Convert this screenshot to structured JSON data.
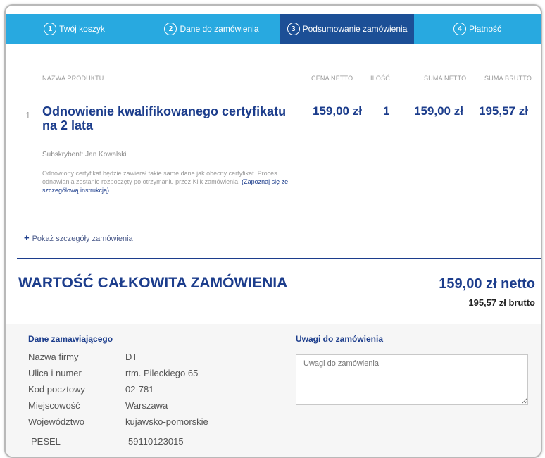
{
  "steps": [
    {
      "num": "1",
      "label": "Twój koszyk"
    },
    {
      "num": "2",
      "label": "Dane do zamówienia"
    },
    {
      "num": "3",
      "label": "Podsumowanie zamówienia"
    },
    {
      "num": "4",
      "label": "Płatność"
    }
  ],
  "active_step": 3,
  "table": {
    "headers": [
      "NAZWA PRODUKTU",
      "CENA NETTO",
      "ILOŚĆ",
      "SUMA NETTO",
      "SUMA BRUTTO"
    ],
    "row": {
      "index": "1",
      "name": "Odnowienie kwalifikowanego certyfikatu na 2 lata",
      "price_net": "159,00 zł",
      "qty": "1",
      "sum_net": "159,00 zł",
      "sum_gross": "195,57 zł"
    },
    "subscriber": "Subskrybent: Jan Kowalski",
    "note_text": "Odnowiony certyfikat będzie zawierał takie same dane jak obecny certyfikat. Proces odnawiania zostanie rozpoczęty po otrzymaniu przez Klik zamówienia. ",
    "note_link": "(Zapoznaj się ze szczegółową instrukcją)"
  },
  "details_toggle": "Pokaż szczegóły zamówienia",
  "total": {
    "label": "WARTOŚĆ CAŁKOWITA ZAMÓWIENIA",
    "netto": "159,00 zł netto",
    "brutto": "195,57 zł brutto"
  },
  "orderer": {
    "title": "Dane zamawiającego",
    "fields": [
      {
        "label": "Nazwa firmy",
        "value": "DT"
      },
      {
        "label": "Ulica i numer",
        "value": "rtm. Pileckiego 65"
      },
      {
        "label": "Kod pocztowy",
        "value": "02-781"
      },
      {
        "label": "Miejscowość",
        "value": "Warszawa"
      },
      {
        "label": "Województwo",
        "value": "kujawsko-pomorskie"
      },
      {
        "label": "PESEL",
        "value": "59110123015"
      }
    ]
  },
  "notes": {
    "title": "Uwagi do zamówienia",
    "placeholder": "Uwagi do zamówienia"
  },
  "colors": {
    "steps_bg": "#28a9e0",
    "step_active": "#1c4f96",
    "brand_navy": "#1c3d8c"
  }
}
